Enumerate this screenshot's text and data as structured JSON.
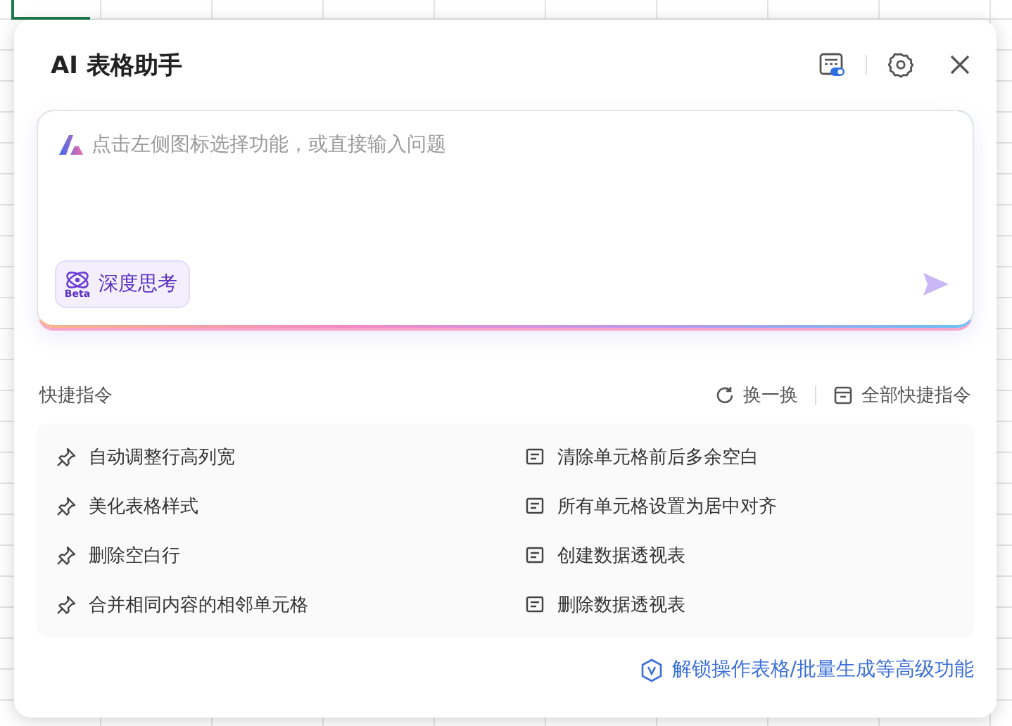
{
  "window": {
    "title": "AI 表格助手"
  },
  "input": {
    "placeholder": "点击左侧图标选择功能，或直接输入问题",
    "deep_think": {
      "label": "深度思考",
      "badge": "Beta",
      "selected": false
    }
  },
  "quick_commands": {
    "title": "快捷指令",
    "refresh": "换一换",
    "all": "全部快捷指令",
    "items": [
      {
        "kind": "pin",
        "label": "自动调整行高列宽"
      },
      {
        "kind": "doc",
        "label": "清除单元格前后多余空白"
      },
      {
        "kind": "pin",
        "label": "美化表格样式"
      },
      {
        "kind": "doc",
        "label": "所有单元格设置为居中对齐"
      },
      {
        "kind": "pin",
        "label": "删除空白行"
      },
      {
        "kind": "doc",
        "label": "创建数据透视表"
      },
      {
        "kind": "pin",
        "label": "合并相同内容的相邻单元格"
      },
      {
        "kind": "doc",
        "label": "删除数据透视表"
      }
    ]
  },
  "footer": {
    "link": "解锁操作表格/批量生成等高级功能"
  }
}
